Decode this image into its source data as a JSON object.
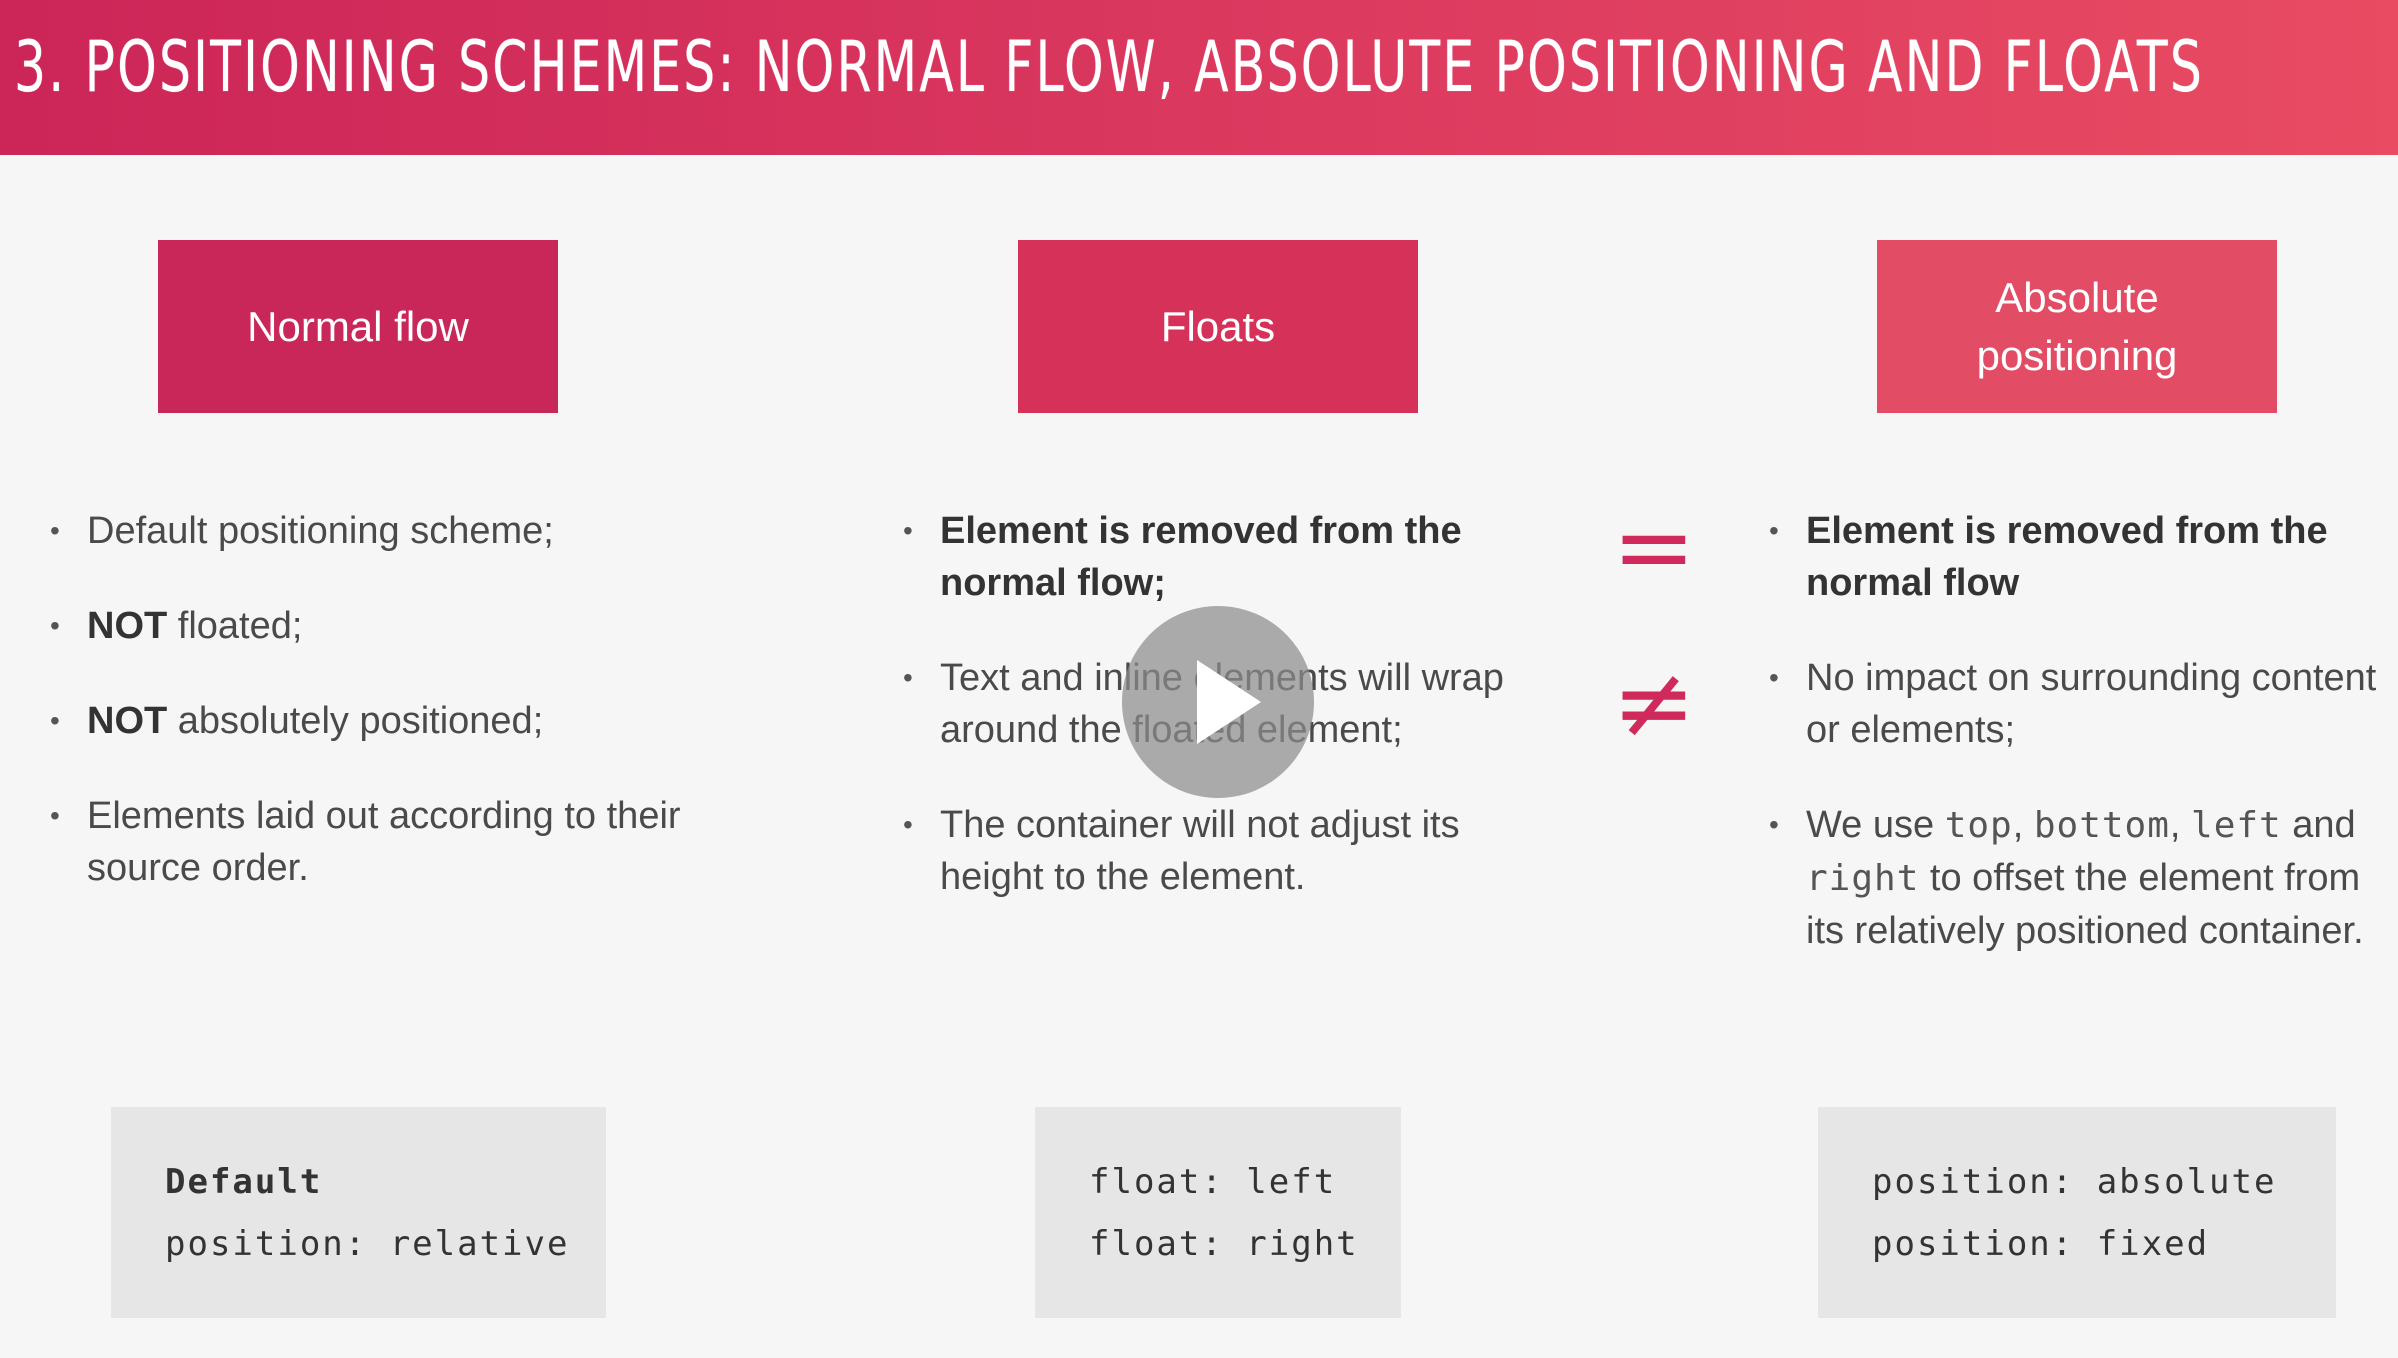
{
  "header": {
    "title": "3. Positioning Schemes: Normal Flow, Absolute Positioning and Floats"
  },
  "boxes": {
    "normal": "Normal flow",
    "floats": "Floats",
    "absolute": "Absolute positioning"
  },
  "normal_flow": {
    "items": [
      {
        "text": "Default positioning scheme;"
      },
      {
        "strong": "NOT",
        "text": " floated;"
      },
      {
        "strong": "NOT",
        "text": " absolutely positioned;"
      },
      {
        "text": "Elements laid out according to their source order."
      }
    ]
  },
  "floats": {
    "items": [
      {
        "strong": "Element is removed from the normal flow;"
      },
      {
        "text": "Text and inline elements will wrap around the floated element;"
      },
      {
        "text": "The container will not adjust its height to the element."
      }
    ]
  },
  "absolute": {
    "item1": "Element is removed from the normal flow",
    "item2": "No impact on surrounding content or elements;",
    "item3": {
      "pre": "We use ",
      "code1": "top",
      "sep1": ", ",
      "code2": "bottom",
      "sep2": ", ",
      "code3": "left",
      "mid": " and ",
      "code4": "right",
      "post": " to offset the element from its relatively positioned container."
    }
  },
  "symbols": {
    "equal": "=",
    "not_equal": "≠"
  },
  "code": {
    "normal": [
      "Default",
      "position: relative"
    ],
    "floats": [
      "float: left",
      "float: right"
    ],
    "absolute": [
      "position: absolute",
      "position: fixed"
    ]
  },
  "icons": {
    "play": "play-icon"
  },
  "colors": {
    "header_start": "#cc2558",
    "header_end": "#e84b62",
    "accent": "#d02a5c"
  }
}
